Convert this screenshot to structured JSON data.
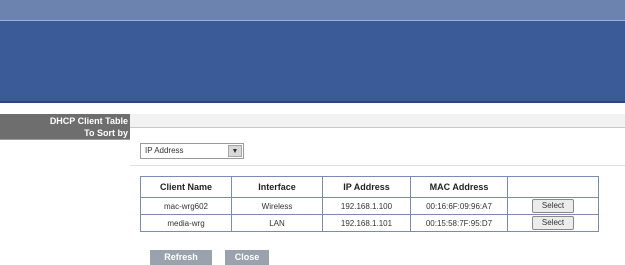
{
  "sidebar": {
    "section_title": "DHCP Client Table",
    "sort_label": "To Sort by"
  },
  "sort": {
    "selected": "IP Address"
  },
  "table": {
    "headers": [
      "Client Name",
      "Interface",
      "IP Address",
      "MAC Address",
      ""
    ],
    "rows": [
      {
        "client_name": "mac-wrg602",
        "interface": "Wireless",
        "ip": "192.168.1.100",
        "mac": "00:16:6F:09:96:A7",
        "action": "Select"
      },
      {
        "client_name": "media-wrg",
        "interface": "LAN",
        "ip": "192.168.1.101",
        "mac": "00:15:58:7F:95:D7",
        "action": "Select"
      }
    ]
  },
  "buttons": {
    "refresh": "Refresh",
    "close": "Close"
  },
  "colors": {
    "banner": "#3a5a98",
    "sidebar": "#6e6e6e",
    "table_border": "#7a8cb5",
    "button": "#9aa3ad"
  }
}
